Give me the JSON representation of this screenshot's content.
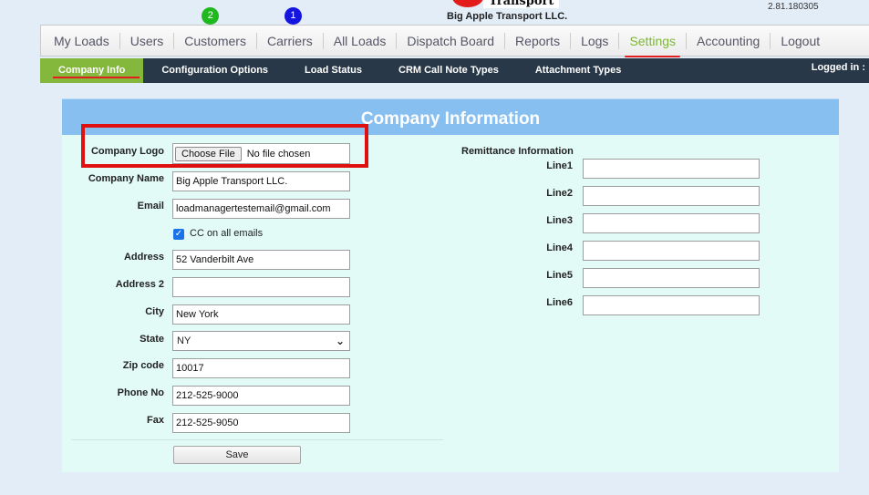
{
  "header": {
    "logo_text": "Transport",
    "company_name": "Big Apple Transport LLC.",
    "version": "2.81.180305"
  },
  "main_nav": {
    "items": [
      {
        "label": "My Loads"
      },
      {
        "label": "Users"
      },
      {
        "label": "Customers",
        "badge": "2"
      },
      {
        "label": "Carriers",
        "badge": "1"
      },
      {
        "label": "All Loads"
      },
      {
        "label": "Dispatch Board"
      },
      {
        "label": "Reports"
      },
      {
        "label": "Logs"
      },
      {
        "label": "Settings"
      },
      {
        "label": "Accounting"
      },
      {
        "label": "Logout"
      }
    ],
    "active": "Settings"
  },
  "sub_nav": {
    "items": [
      {
        "label": "Company Info"
      },
      {
        "label": "Configuration Options"
      },
      {
        "label": "Load Status"
      },
      {
        "label": "CRM Call Note Types"
      },
      {
        "label": "Attachment Types"
      }
    ],
    "logged_in": "Logged in :"
  },
  "form": {
    "title": "Company Information",
    "company_logo_label": "Company Logo",
    "file_button": "Choose File",
    "file_status": "No file chosen",
    "company_name_label": "Company Name",
    "company_name_value": "Big Apple Transport LLC.",
    "email_label": "Email",
    "email_value": "loadmanagertestemail@gmail.com",
    "cc_label": "CC on all emails",
    "address_label": "Address",
    "address_value": "52 Vanderbilt Ave",
    "address2_label": "Address 2",
    "address2_value": "",
    "city_label": "City",
    "city_value": "New York",
    "state_label": "State",
    "state_value": "NY",
    "zip_label": "Zip code",
    "zip_value": "10017",
    "phone_label": "Phone No",
    "phone_value": "212-525-9000",
    "fax_label": "Fax",
    "fax_value": "212-525-9050",
    "save_label": "Save"
  },
  "remittance": {
    "title": "Remittance Information",
    "lines": [
      {
        "label": "Line1",
        "value": ""
      },
      {
        "label": "Line2",
        "value": ""
      },
      {
        "label": "Line3",
        "value": ""
      },
      {
        "label": "Line4",
        "value": ""
      },
      {
        "label": "Line5",
        "value": ""
      },
      {
        "label": "Line6",
        "value": ""
      }
    ]
  },
  "colors": {
    "active_nav": "#7cb733",
    "subnav_bg": "#283848",
    "panel_header": "#86bff0",
    "panel_bg": "#e3fbf7",
    "highlight": "#e01010"
  }
}
